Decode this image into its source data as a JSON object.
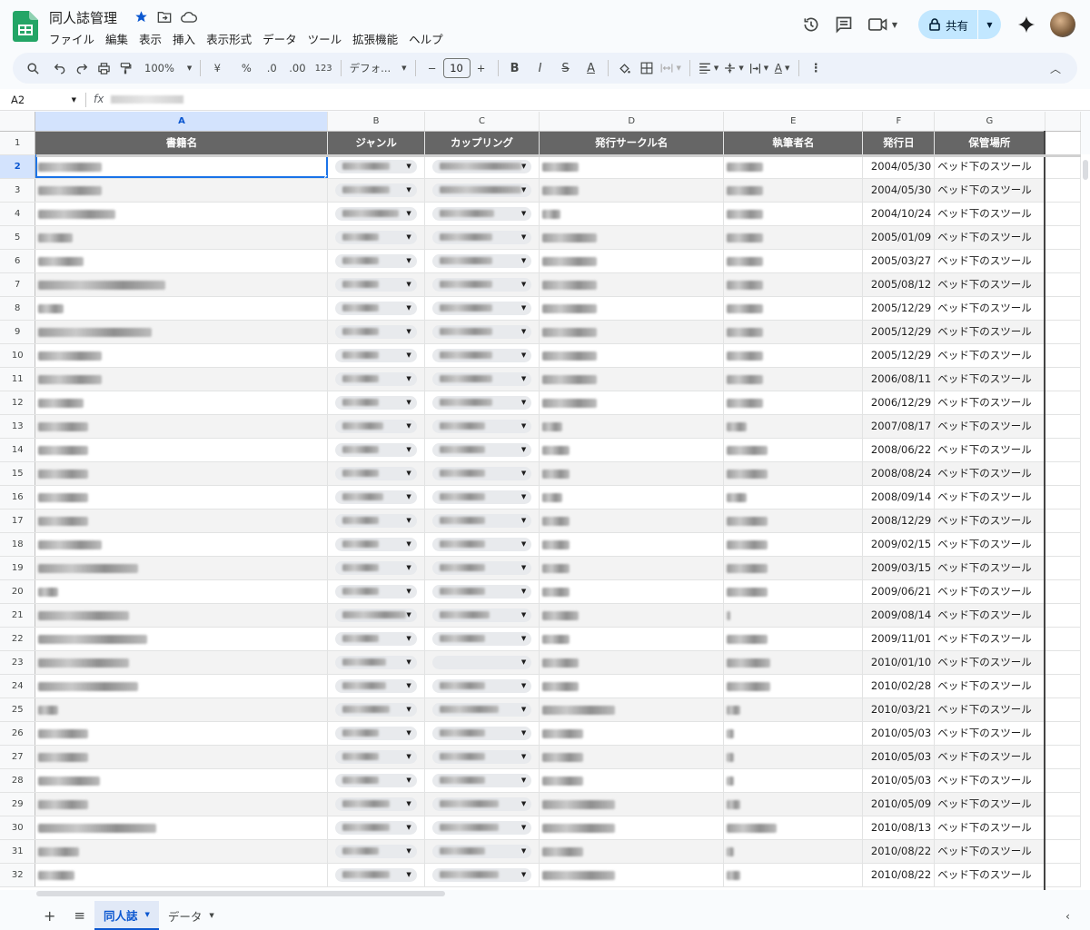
{
  "app": {
    "doc_title": "同人誌管理",
    "accent": "#0b57d0"
  },
  "menu": [
    "ファイル",
    "編集",
    "表示",
    "挿入",
    "表示形式",
    "データ",
    "ツール",
    "拡張機能",
    "ヘルプ"
  ],
  "share": {
    "label": "共有"
  },
  "toolbar": {
    "zoom": "100%",
    "currency": "¥",
    "percent": "%",
    "dec_less": ".0",
    "dec_more": ".00",
    "number_format": "123",
    "font": "デフォ...",
    "font_size": "10"
  },
  "formula_bar": {
    "cell_ref": "A2",
    "fx": "fx"
  },
  "columns": [
    "A",
    "B",
    "C",
    "D",
    "E",
    "F",
    "G"
  ],
  "headers": [
    "書籍名",
    "ジャンル",
    "カップリング",
    "発行サークル名",
    "執筆者名",
    "発行日",
    "保管場所"
  ],
  "rows": [
    {
      "n": "2",
      "date": "2004/05/30",
      "place": "ベッド下のスツール"
    },
    {
      "n": "3",
      "date": "2004/05/30",
      "place": "ベッド下のスツール"
    },
    {
      "n": "4",
      "date": "2004/10/24",
      "place": "ベッド下のスツール"
    },
    {
      "n": "5",
      "date": "2005/01/09",
      "place": "ベッド下のスツール"
    },
    {
      "n": "6",
      "date": "2005/03/27",
      "place": "ベッド下のスツール"
    },
    {
      "n": "7",
      "date": "2005/08/12",
      "place": "ベッド下のスツール"
    },
    {
      "n": "8",
      "date": "2005/12/29",
      "place": "ベッド下のスツール"
    },
    {
      "n": "9",
      "date": "2005/12/29",
      "place": "ベッド下のスツール"
    },
    {
      "n": "10",
      "date": "2005/12/29",
      "place": "ベッド下のスツール"
    },
    {
      "n": "11",
      "date": "2006/08/11",
      "place": "ベッド下のスツール"
    },
    {
      "n": "12",
      "date": "2006/12/29",
      "place": "ベッド下のスツール"
    },
    {
      "n": "13",
      "date": "2007/08/17",
      "place": "ベッド下のスツール"
    },
    {
      "n": "14",
      "date": "2008/06/22",
      "place": "ベッド下のスツール"
    },
    {
      "n": "15",
      "date": "2008/08/24",
      "place": "ベッド下のスツール"
    },
    {
      "n": "16",
      "date": "2008/09/14",
      "place": "ベッド下のスツール"
    },
    {
      "n": "17",
      "date": "2008/12/29",
      "place": "ベッド下のスツール"
    },
    {
      "n": "18",
      "date": "2009/02/15",
      "place": "ベッド下のスツール"
    },
    {
      "n": "19",
      "date": "2009/03/15",
      "place": "ベッド下のスツール"
    },
    {
      "n": "20",
      "date": "2009/06/21",
      "place": "ベッド下のスツール"
    },
    {
      "n": "21",
      "date": "2009/08/14",
      "place": "ベッド下のスツール"
    },
    {
      "n": "22",
      "date": "2009/11/01",
      "place": "ベッド下のスツール"
    },
    {
      "n": "23",
      "date": "2010/01/10",
      "place": "ベッド下のスツール"
    },
    {
      "n": "24",
      "date": "2010/02/28",
      "place": "ベッド下のスツール"
    },
    {
      "n": "25",
      "date": "2010/03/21",
      "place": "ベッド下のスツール"
    },
    {
      "n": "26",
      "date": "2010/05/03",
      "place": "ベッド下のスツール"
    },
    {
      "n": "27",
      "date": "2010/05/03",
      "place": "ベッド下のスツール"
    },
    {
      "n": "28",
      "date": "2010/05/03",
      "place": "ベッド下のスツール"
    },
    {
      "n": "29",
      "date": "2010/05/09",
      "place": "ベッド下のスツール"
    },
    {
      "n": "30",
      "date": "2010/08/13",
      "place": "ベッド下のスツール"
    },
    {
      "n": "31",
      "date": "2010/08/22",
      "place": "ベッド下のスツール"
    },
    {
      "n": "32",
      "date": "2010/08/22",
      "place": "ベッド下のスツール"
    }
  ],
  "sheets": [
    {
      "label": "同人誌",
      "active": true
    },
    {
      "label": "データ",
      "active": false
    }
  ]
}
